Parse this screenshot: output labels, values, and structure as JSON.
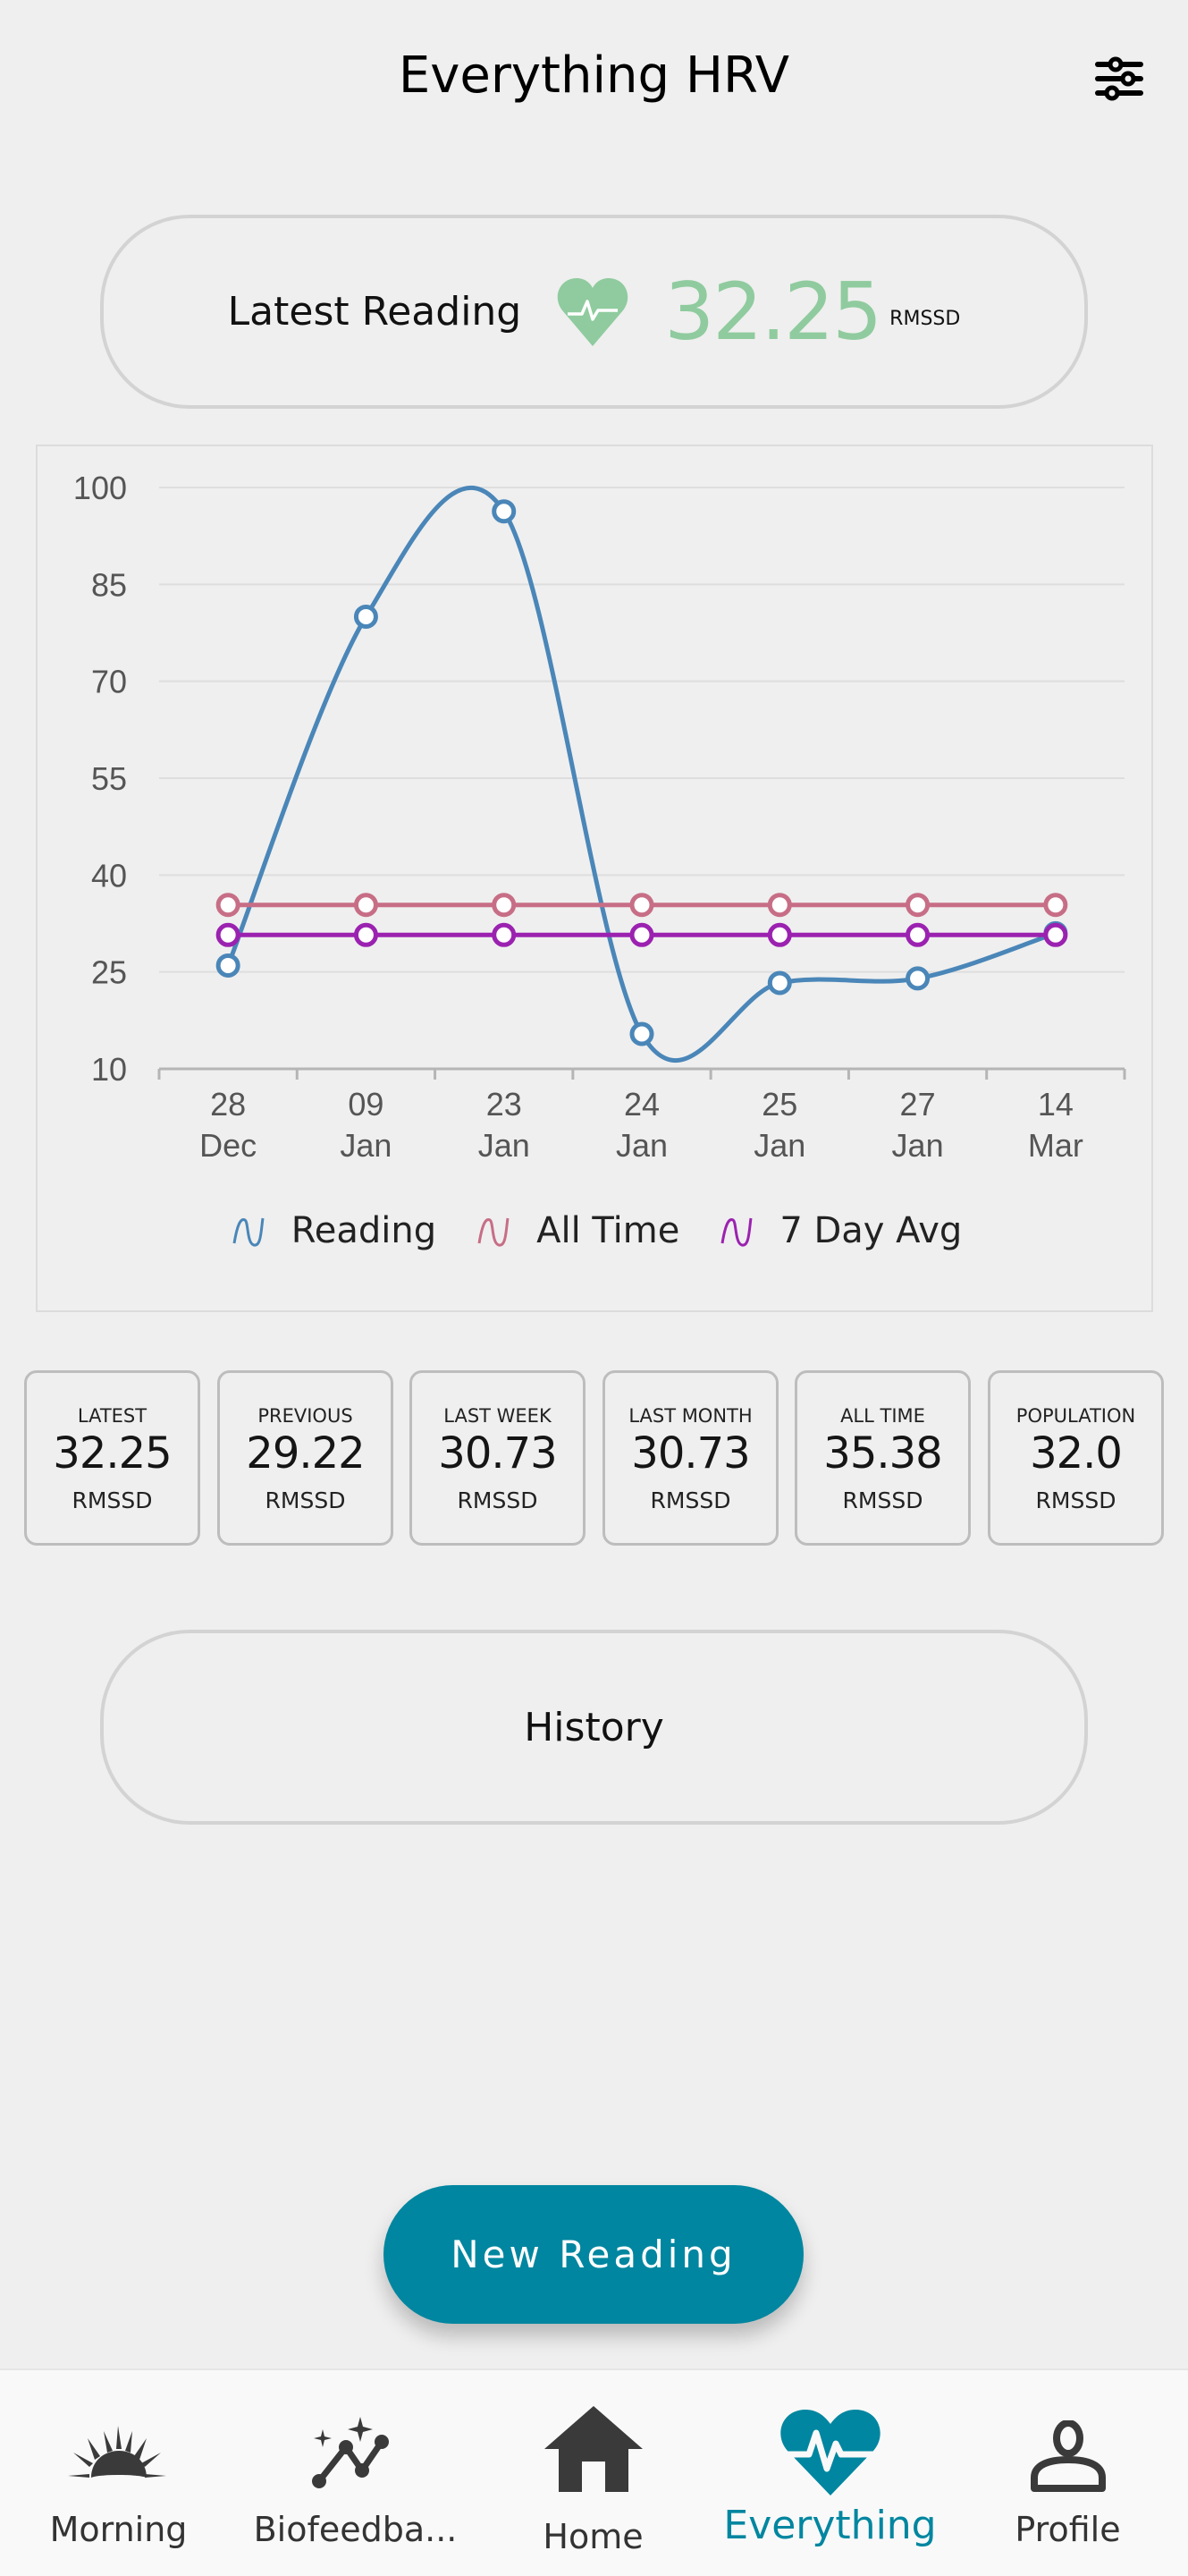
{
  "header": {
    "title": "Everything HRV",
    "settings_icon": "sliders-icon"
  },
  "latest_reading": {
    "label": "Latest Reading",
    "icon": "heart-pulse-icon",
    "value": "32.25",
    "unit": "RMSSD",
    "accent_color": "#8fcb9e"
  },
  "chart_data": {
    "type": "line",
    "title": "",
    "xlabel": "",
    "ylabel": "",
    "categories": [
      "28 Dec",
      "09 Jan",
      "23 Jan",
      "24 Jan",
      "25 Jan",
      "27 Jan",
      "14 Mar"
    ],
    "category_lines": [
      [
        "28",
        "Dec"
      ],
      [
        "09",
        "Jan"
      ],
      [
        "23",
        "Jan"
      ],
      [
        "24",
        "Jan"
      ],
      [
        "25",
        "Jan"
      ],
      [
        "27",
        "Jan"
      ],
      [
        "14",
        "Mar"
      ]
    ],
    "ylim": [
      10,
      100
    ],
    "yticks": [
      100,
      85,
      70,
      55,
      40,
      25,
      10
    ],
    "grid": true,
    "legend_position": "bottom",
    "series": [
      {
        "name": "Reading",
        "color": "#4a86b8",
        "smooth": true,
        "values": [
          26,
          80,
          96.3,
          15.4,
          23.3,
          24.0,
          31
        ]
      },
      {
        "name": "All Time",
        "color": "#c76e86",
        "smooth": false,
        "values": [
          35.38,
          35.38,
          35.38,
          35.38,
          35.38,
          35.38,
          35.38
        ]
      },
      {
        "name": "7 Day Avg",
        "color": "#9b22b0",
        "smooth": false,
        "values": [
          30.73,
          30.73,
          30.73,
          30.73,
          30.73,
          30.73,
          30.73
        ]
      }
    ]
  },
  "stats": [
    {
      "title": "LATEST",
      "value": "32.25",
      "unit": "RMSSD"
    },
    {
      "title": "PREVIOUS",
      "value": "29.22",
      "unit": "RMSSD"
    },
    {
      "title": "LAST WEEK",
      "value": "30.73",
      "unit": "RMSSD"
    },
    {
      "title": "LAST MONTH",
      "value": "30.73",
      "unit": "RMSSD"
    },
    {
      "title": "ALL TIME",
      "value": "35.38",
      "unit": "RMSSD"
    },
    {
      "title": "POPULATION",
      "value": "32.0",
      "unit": "RMSSD"
    }
  ],
  "history": {
    "label": "History"
  },
  "new_reading": {
    "label": "New Reading",
    "color": "#0086a0"
  },
  "bottom_nav": {
    "active_color": "#0086a0",
    "items": [
      {
        "label": "Morning",
        "icon": "sunrise-icon",
        "active": false
      },
      {
        "label": "Biofeedba...",
        "icon": "sparkle-chart-icon",
        "active": false
      },
      {
        "label": "Home",
        "icon": "home-icon",
        "active": false
      },
      {
        "label": "Everything",
        "icon": "heart-pulse-icon",
        "active": true
      },
      {
        "label": "Profile",
        "icon": "person-icon",
        "active": false
      }
    ]
  }
}
